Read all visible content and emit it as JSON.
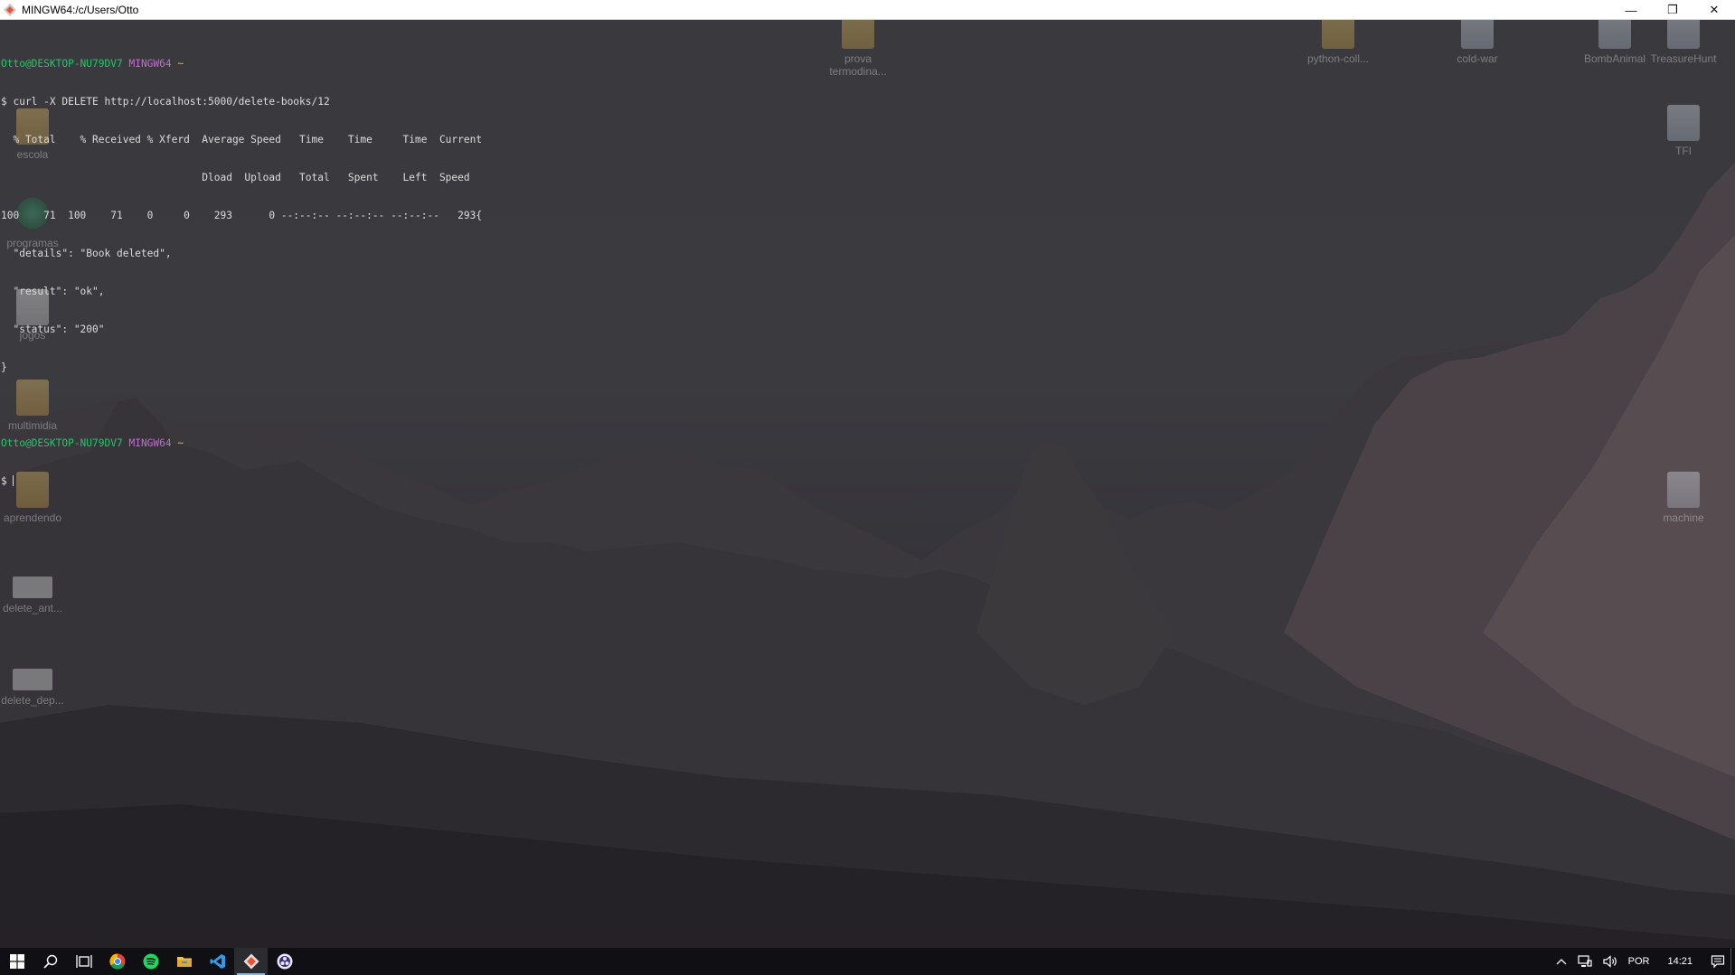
{
  "window": {
    "title": "MINGW64:/c/Users/Otto",
    "minimize_glyph": "—",
    "restore_glyph": "❐",
    "close_glyph": "✕"
  },
  "terminal": {
    "prompt1": {
      "user_host": "Otto@DESKTOP-NU79DV7",
      "shell": "MINGW64",
      "path": "~"
    },
    "command": "$ curl -X DELETE http://localhost:5000/delete-books/12",
    "header1": "  % Total    % Received % Xferd  Average Speed   Time    Time     Time  Current",
    "header2": "                                 Dload  Upload   Total   Spent    Left  Speed",
    "progress": "100    71  100    71    0     0    293      0 --:--:-- --:--:-- --:--:--   293{",
    "json_lines": [
      "  \"details\": \"Book deleted\",",
      "  \"result\": \"ok\",",
      "  \"status\": \"200\"",
      "}"
    ],
    "prompt2": {
      "user_host": "Otto@DESKTOP-NU79DV7",
      "shell": "MINGW64",
      "path": "~"
    },
    "input_prompt": "$ "
  },
  "desktop_icons_left": [
    {
      "label": "escola",
      "type": "folder"
    },
    {
      "label": "programas",
      "type": "app"
    },
    {
      "label": "jogos",
      "type": "file"
    },
    {
      "label": "multimidia",
      "type": "folder"
    },
    {
      "label": "aprendendo",
      "type": "folder"
    },
    {
      "label": "delete_ant...",
      "type": "term"
    },
    {
      "label": "delete_dep...",
      "type": "term"
    }
  ],
  "desktop_icons_top": [
    {
      "label": "prova termodina...",
      "type": "folder"
    },
    {
      "label": "python-coll...",
      "type": "folder"
    },
    {
      "label": "cold-war",
      "type": "zip"
    },
    {
      "label": "BombAnimal",
      "type": "zip"
    },
    {
      "label": "TreasureHunt",
      "type": "zip"
    }
  ],
  "desktop_icons_right": [
    {
      "label": "TFI",
      "type": "zip"
    },
    {
      "label": "machine",
      "type": "zip"
    }
  ],
  "taskbar": {
    "apps": [
      "start-icon",
      "search-icon",
      "task-view-icon",
      "chrome-icon",
      "spotify-icon",
      "file-explorer-icon",
      "vscode-icon",
      "git-bash-icon",
      "obs-icon"
    ],
    "tray": {
      "language": "POR",
      "time": "14:21"
    }
  }
}
